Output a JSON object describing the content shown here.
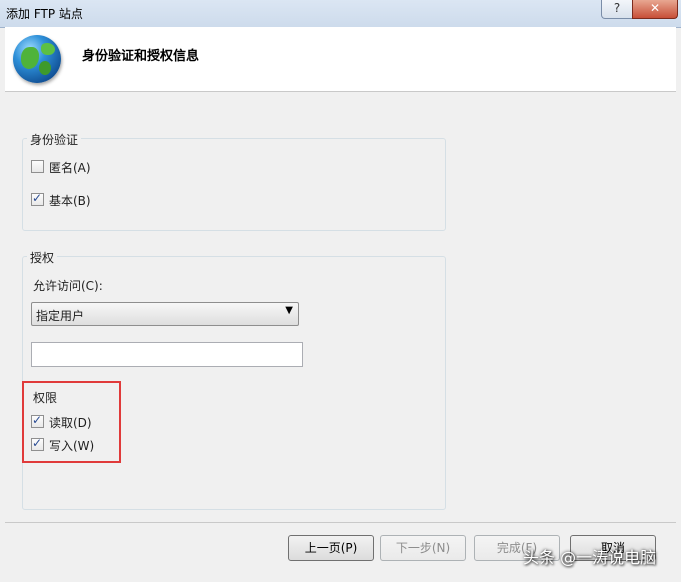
{
  "window": {
    "title": "添加 FTP 站点",
    "help_label": "?",
    "close_label": "✕"
  },
  "header": {
    "heading": "身份验证和授权信息"
  },
  "authentication": {
    "legend": "身份验证",
    "anonymous": {
      "label": "匿名(A)",
      "checked": false
    },
    "basic": {
      "label": "基本(B)",
      "checked": true
    }
  },
  "authorization": {
    "legend": "授权",
    "allow_access_label": "允许访问(C):",
    "allow_access_value": "指定用户",
    "users_input_value": "",
    "permissions": {
      "legend": "权限",
      "read": {
        "label": "读取(D)",
        "checked": true
      },
      "write": {
        "label": "写入(W)",
        "checked": true
      }
    }
  },
  "footer": {
    "prev_label": "上一页(P)",
    "next_label": "下一步(N)",
    "finish_label": "完成(F)",
    "cancel_label": "取消"
  },
  "watermark": "头条 @一涛说电脑",
  "colors": {
    "highlight_box": "#e03a3a",
    "check_color": "#2a4c93",
    "close_button": "#c74f38"
  },
  "icons": {
    "site": "globe-icon",
    "dropdown": "chevron-down-icon"
  }
}
